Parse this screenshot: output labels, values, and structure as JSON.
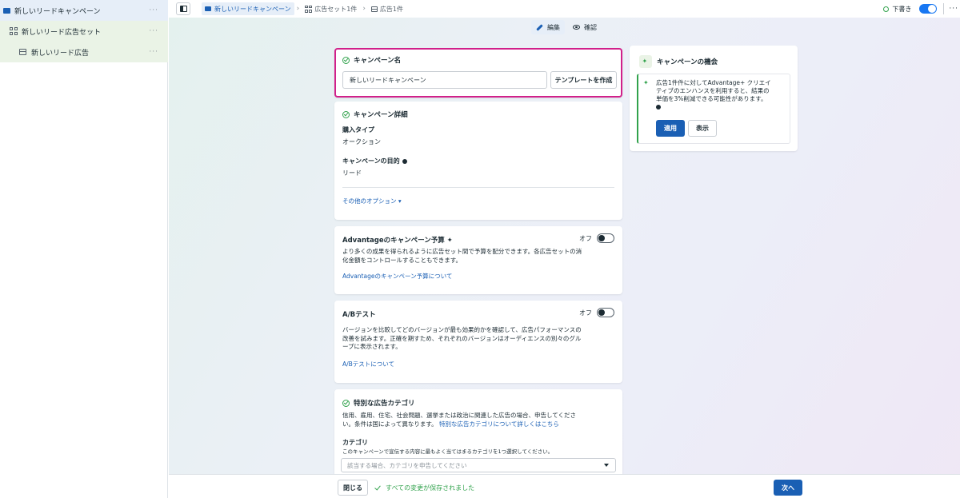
{
  "sidebar": {
    "campaign": "新しいリードキャンペーン",
    "adset": "新しいリード広告セット",
    "ad": "新しいリード広告",
    "more": "···"
  },
  "topbar": {
    "breadcrumb": {
      "campaign": "新しいリードキャンペーン",
      "adset": "広告セット1件",
      "ad": "広告1件"
    },
    "draft_label": "下書き",
    "more": "···"
  },
  "modes": {
    "edit": "編集",
    "review": "確認"
  },
  "campaign_name_card": {
    "title": "キャンペーン名",
    "name_value": "新しいリードキャンペーン",
    "template_button": "テンプレートを作成"
  },
  "details_card": {
    "title": "キャンペーン詳細",
    "buying_type_label": "購入タイプ",
    "buying_type_value": "オークション",
    "objective_label": "キャンペーンの目的",
    "objective_value": "リード",
    "more_options": "その他のオプション ▾"
  },
  "budget_card": {
    "title": "Advantageのキャンペーン予算 ✦",
    "switch_label": "オフ",
    "description_line1": "より多くの成果を得られるように広告セット間で予算を配分できます。各広告セットの消",
    "description_line2": "化金額をコントロールすることもできます。",
    "link": "Advantageのキャンペーン予算について"
  },
  "ab_card": {
    "title": "A/Bテスト",
    "switch_label": "オフ",
    "description_line1": "バージョンを比較してどのバージョンが最も効果的かを確認して、広告パフォーマンスの",
    "description_line2": "改善を試みます。正確を期すため、それぞれのバージョンはオーディエンスの別々のグル",
    "description_line3": "ープに表示されます。",
    "link": "A/Bテストについて"
  },
  "special_card": {
    "title": "特別な広告カテゴリ",
    "description_line1": "信用、雇用、住宅、社会問題、選挙または政治に関連した広告の場合、申告してくださ",
    "description_line2_prefix": "い。条件は国によって異なります。",
    "description_link": "特別な広告カテゴリについて詳しくはこちら",
    "category_label": "カテゴリ",
    "category_help": "このキャンペーンで宣伝する内容に最もよく当てはまるカテゴリを1つ選択してください。",
    "select_placeholder": "該当する場合、カテゴリを申告してください"
  },
  "opportunity_card": {
    "title": "キャンペーンの機会",
    "text_line1": "広告1件件に対してAdvantage+ クリエイ",
    "text_line2": "ティブのエンハンスを利用すると、結果の",
    "text_line3": "単価を3%削減できる可能性があります。",
    "apply_button": "適用",
    "show_button": "表示"
  },
  "footer": {
    "close_button": "閉じる",
    "saved_text": "すべての変更が保存されました",
    "next_button": "次へ"
  },
  "colors": {
    "accent_blue": "#1a5fb4",
    "success_green": "#31a24c",
    "highlight_magenta": "#d1208a"
  }
}
